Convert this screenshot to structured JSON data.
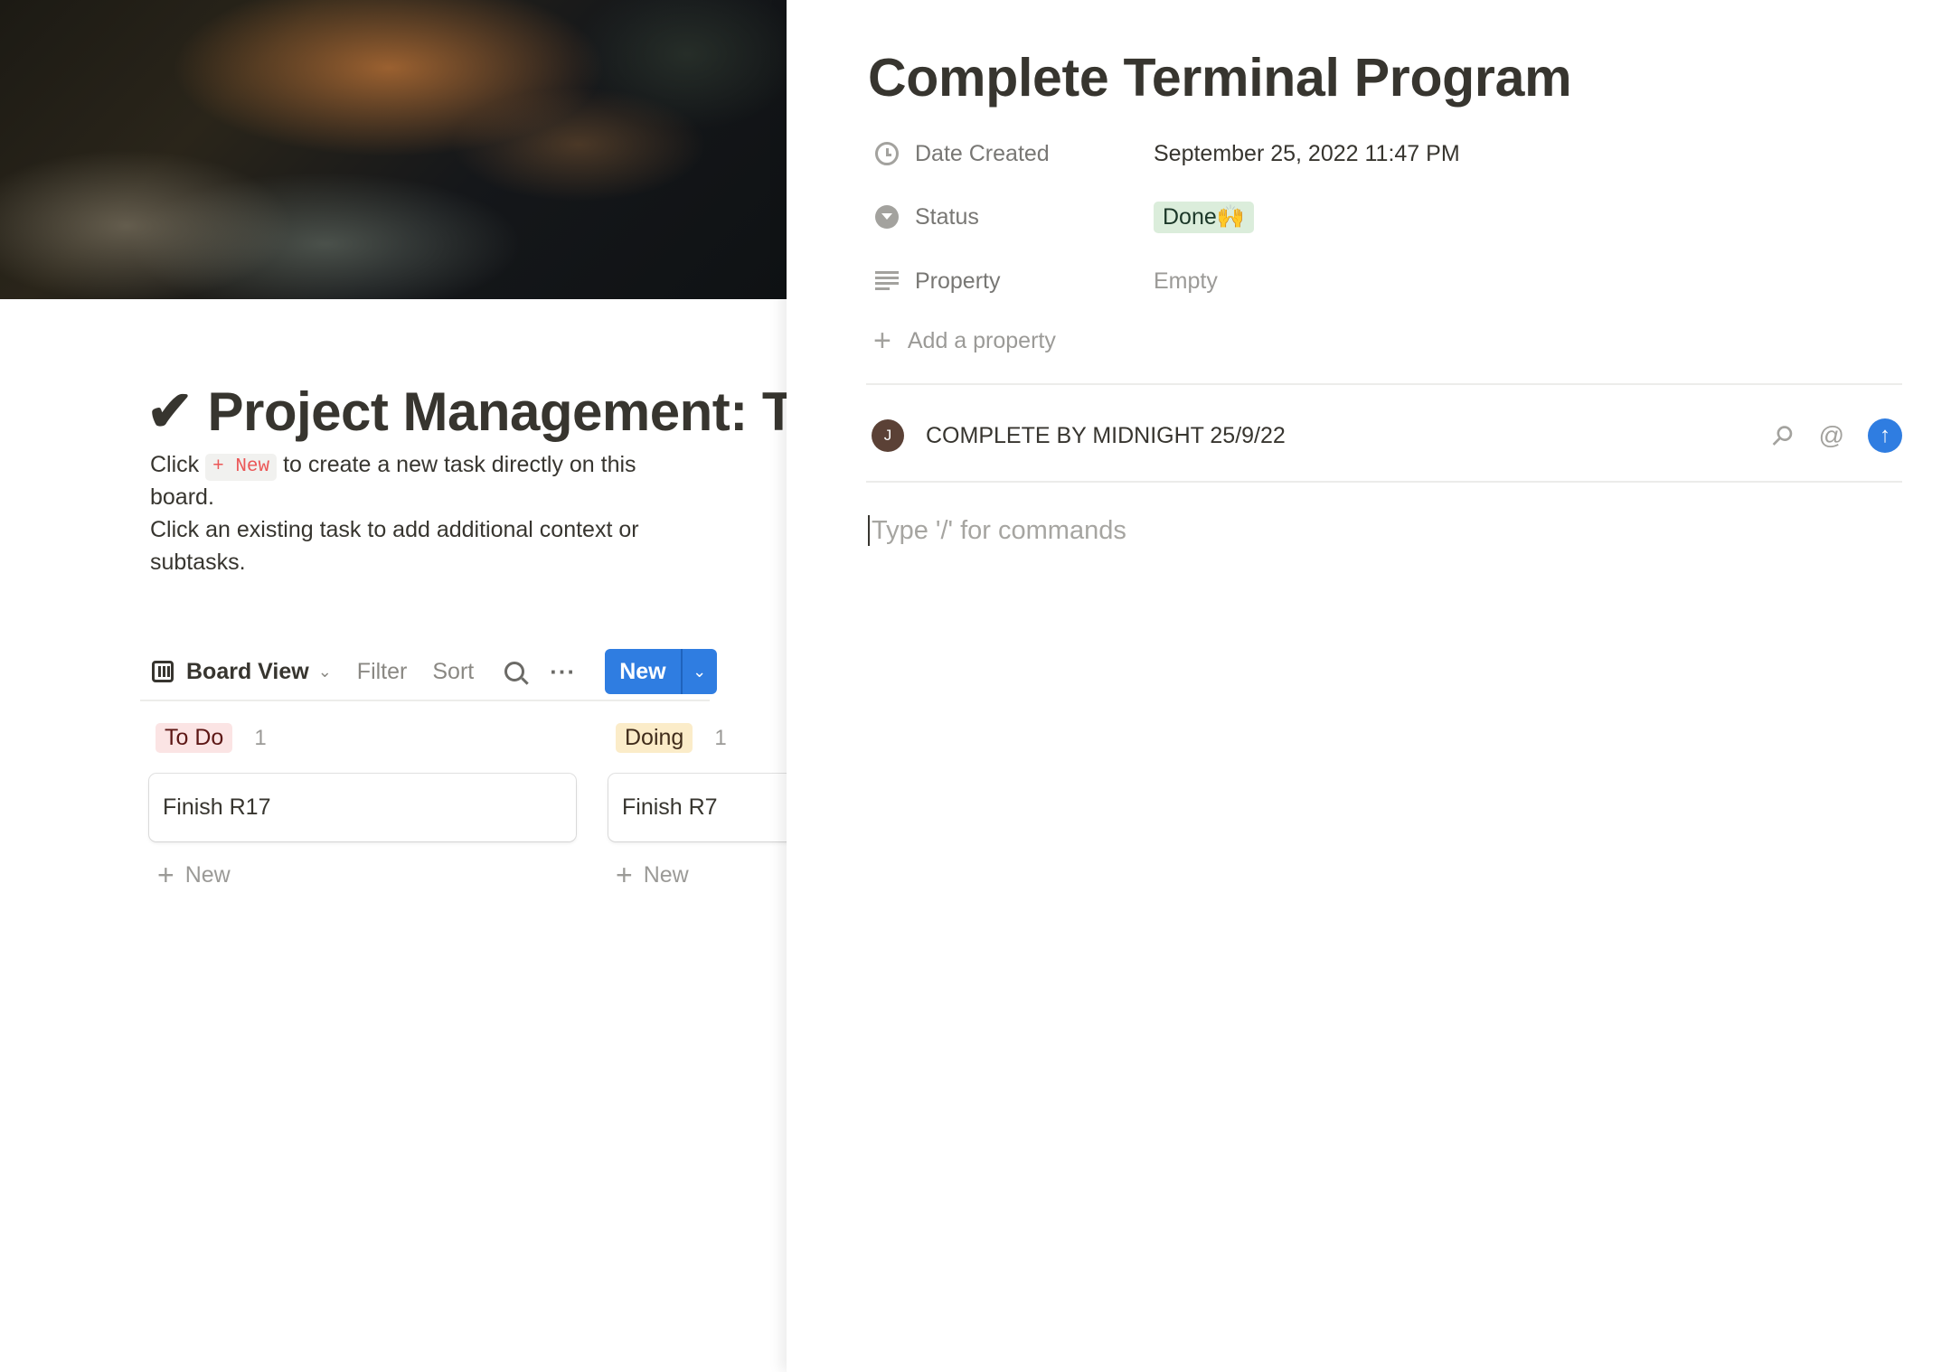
{
  "board_page": {
    "title_icon": "✔",
    "title": "Project Management: To",
    "description": {
      "line1_before": "Click",
      "inline_new": "+ New",
      "line1_after": "to create a new task directly on this board.",
      "line2": "Click an existing task to add additional context or subtasks."
    },
    "toolbar": {
      "view_label": "Board View",
      "filter_label": "Filter",
      "sort_label": "Sort",
      "new_label": "New"
    },
    "groups": [
      {
        "label": "To Do",
        "count": "1",
        "card": "Finish R17",
        "add_label": "New"
      },
      {
        "label": "Doing",
        "count": "1",
        "card": "Finish R7",
        "add_label": "New"
      }
    ]
  },
  "peek": {
    "title": "Complete Terminal Program",
    "properties": [
      {
        "name": "Date Created",
        "value": "September 25, 2022 11:47 PM",
        "icon": "clock-icon"
      },
      {
        "name": "Status",
        "value": "Done🙌",
        "icon": "status-icon"
      },
      {
        "name": "Property",
        "value": "Empty",
        "icon": "text-lines-icon"
      }
    ],
    "add_property_label": "Add a property",
    "comment": {
      "avatar_initial": "J",
      "text": "COMPLETE BY MIDNIGHT 25/9/22"
    },
    "editor_placeholder": "Type '/' for commands"
  },
  "colors": {
    "accent_blue": "#2f7de1",
    "todo_tag_bg": "#fbe4e4",
    "doing_tag_bg": "#fbecc9",
    "done_tag_bg": "#dbeddb"
  }
}
